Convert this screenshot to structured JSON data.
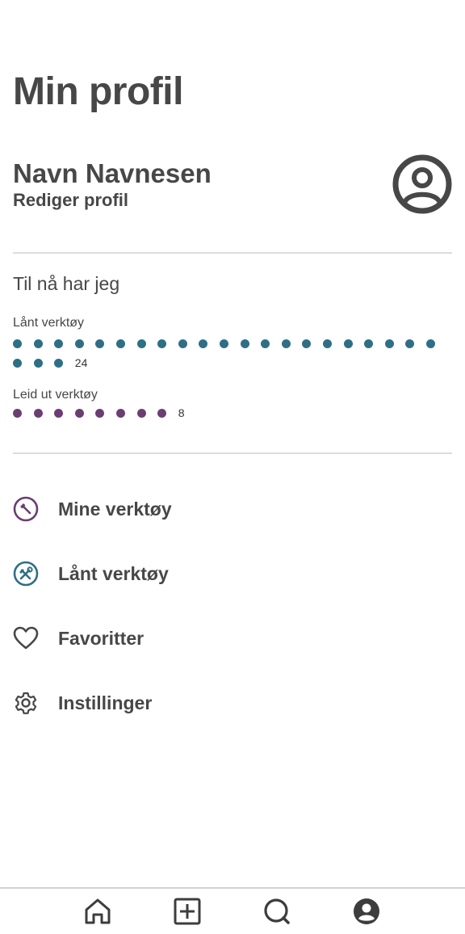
{
  "page": {
    "title": "Min profil"
  },
  "profile": {
    "name": "Navn Navnesen",
    "edit_label": "Rediger profil",
    "avatar_icon": "account-circle-icon"
  },
  "stats": {
    "heading": "Til nå har jeg",
    "borrowed": {
      "label": "Lånt verktøy",
      "count": 24,
      "count_text": "24",
      "color": "#2f6f86"
    },
    "lent": {
      "label": "Leid ut verktøy",
      "count": 8,
      "count_text": "8",
      "color": "#6b3d72"
    }
  },
  "menu": {
    "items": [
      {
        "label": "Mine verktøy",
        "icon": "hammer-circle-icon",
        "color": "#6b3d72"
      },
      {
        "label": "Lånt verktøy",
        "icon": "tools-circle-icon",
        "color": "#2f6f86"
      },
      {
        "label": "Favoritter",
        "icon": "heart-icon",
        "color": "#474747"
      },
      {
        "label": "Instillinger",
        "icon": "gear-icon",
        "color": "#474747"
      }
    ]
  },
  "bottom_nav": {
    "items": [
      {
        "icon": "home-icon"
      },
      {
        "icon": "add-box-icon"
      },
      {
        "icon": "search-icon"
      },
      {
        "icon": "profile-icon",
        "active": true
      }
    ]
  }
}
